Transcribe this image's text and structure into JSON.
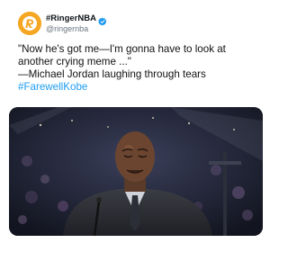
{
  "account": {
    "display_name": "#RingerNBA",
    "handle": "@ringernba",
    "avatar_icon": "ringer-logo-icon",
    "verified_icon": "verified-badge-icon",
    "brand_color": "#f5a623",
    "verified_color": "#1d9bf0"
  },
  "tweet": {
    "line1": "\"Now he's got me—I'm gonna have to look at another crying meme ...\"",
    "line2": "—Michael Jordan laughing through tears",
    "hashtag": "#FarewellKobe",
    "hashtag_color": "#1d9bf0"
  },
  "media": {
    "kind": "photo",
    "subject": "man-at-podium-photo"
  }
}
